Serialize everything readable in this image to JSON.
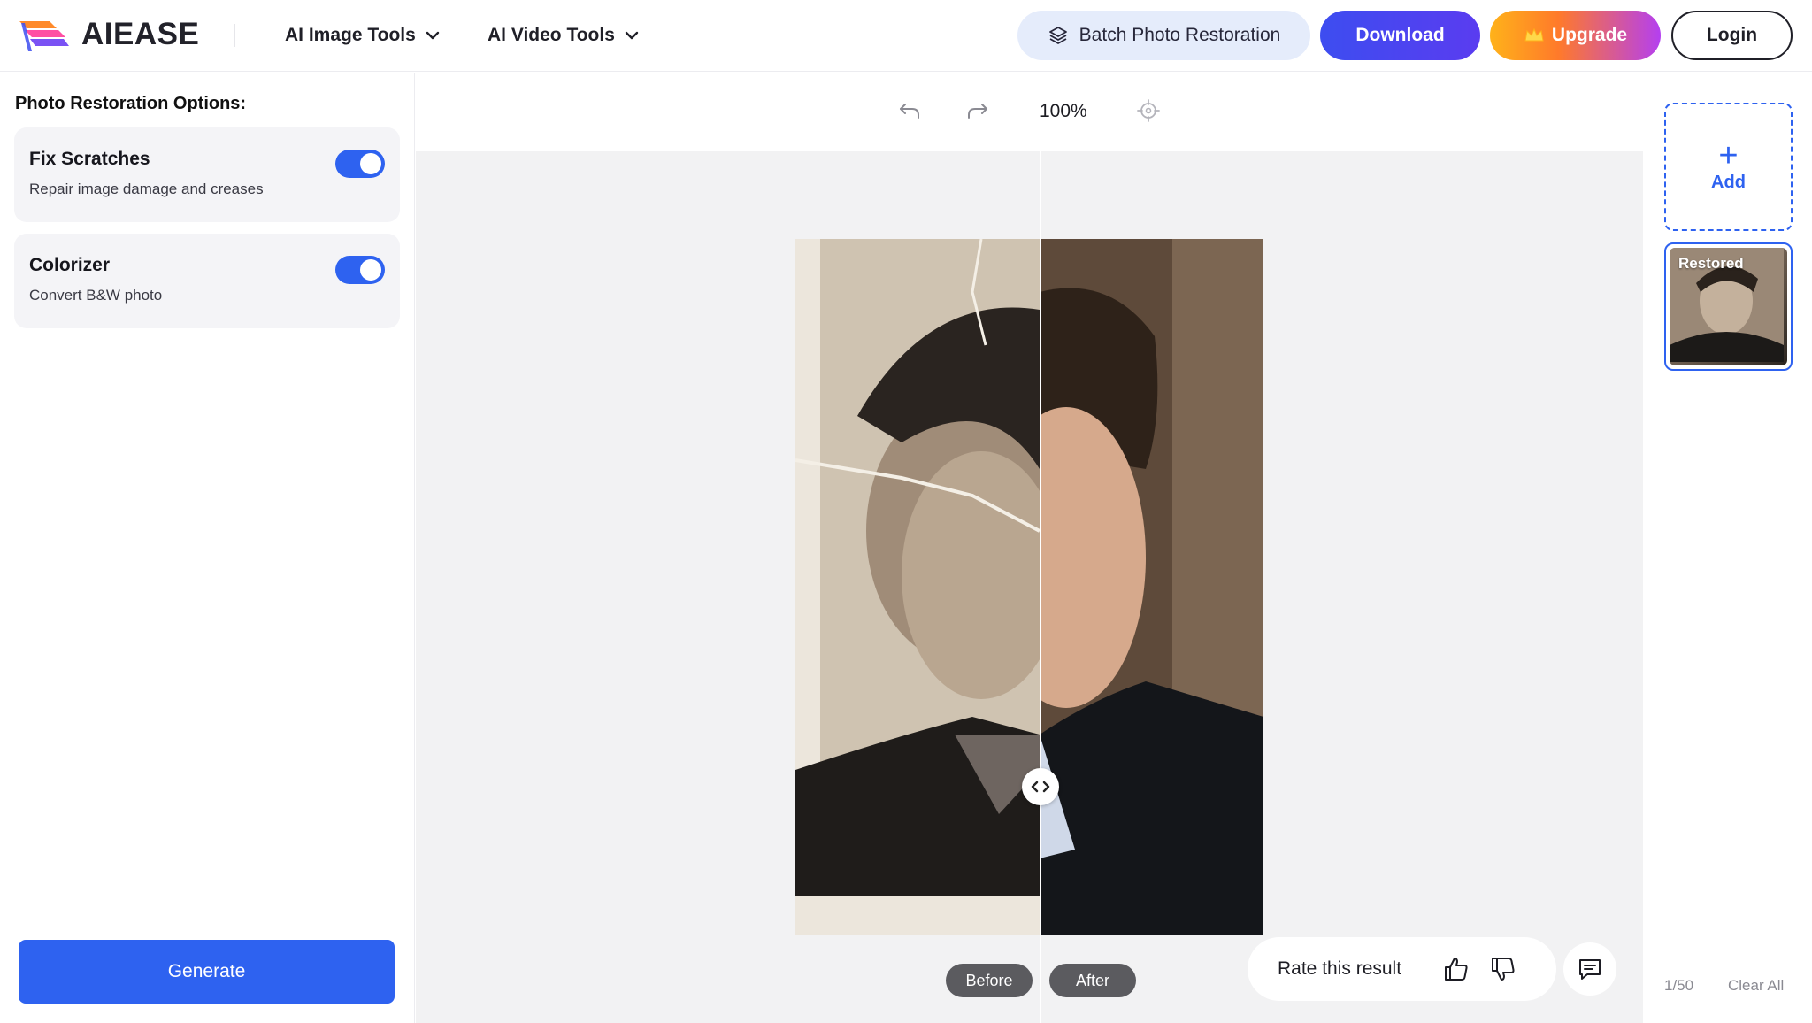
{
  "header": {
    "brand": "AIEASE",
    "nav": [
      {
        "label": "AI Image Tools",
        "icon": "chevron-down-icon"
      },
      {
        "label": "AI Video Tools",
        "icon": "chevron-down-icon"
      }
    ],
    "batch_label": "Batch Photo Restoration",
    "download_label": "Download",
    "upgrade_label": "Upgrade",
    "login_label": "Login"
  },
  "sidebar": {
    "title": "Photo Restoration Options:",
    "options": [
      {
        "title": "Fix Scratches",
        "subtitle": "Repair image damage and creases",
        "enabled": true
      },
      {
        "title": "Colorizer",
        "subtitle": "Convert B&W photo",
        "enabled": true
      }
    ],
    "generate_label": "Generate"
  },
  "canvas": {
    "zoom": "100%",
    "before_label": "Before",
    "after_label": "After",
    "rate_label": "Rate this result"
  },
  "right_panel": {
    "add_label": "Add",
    "thumb_label": "Restored",
    "count": "1/50",
    "clear_label": "Clear All"
  },
  "colors": {
    "accent": "#2e62f0",
    "download": "#4a44f0",
    "batch_bg": "#e5ecfb"
  }
}
